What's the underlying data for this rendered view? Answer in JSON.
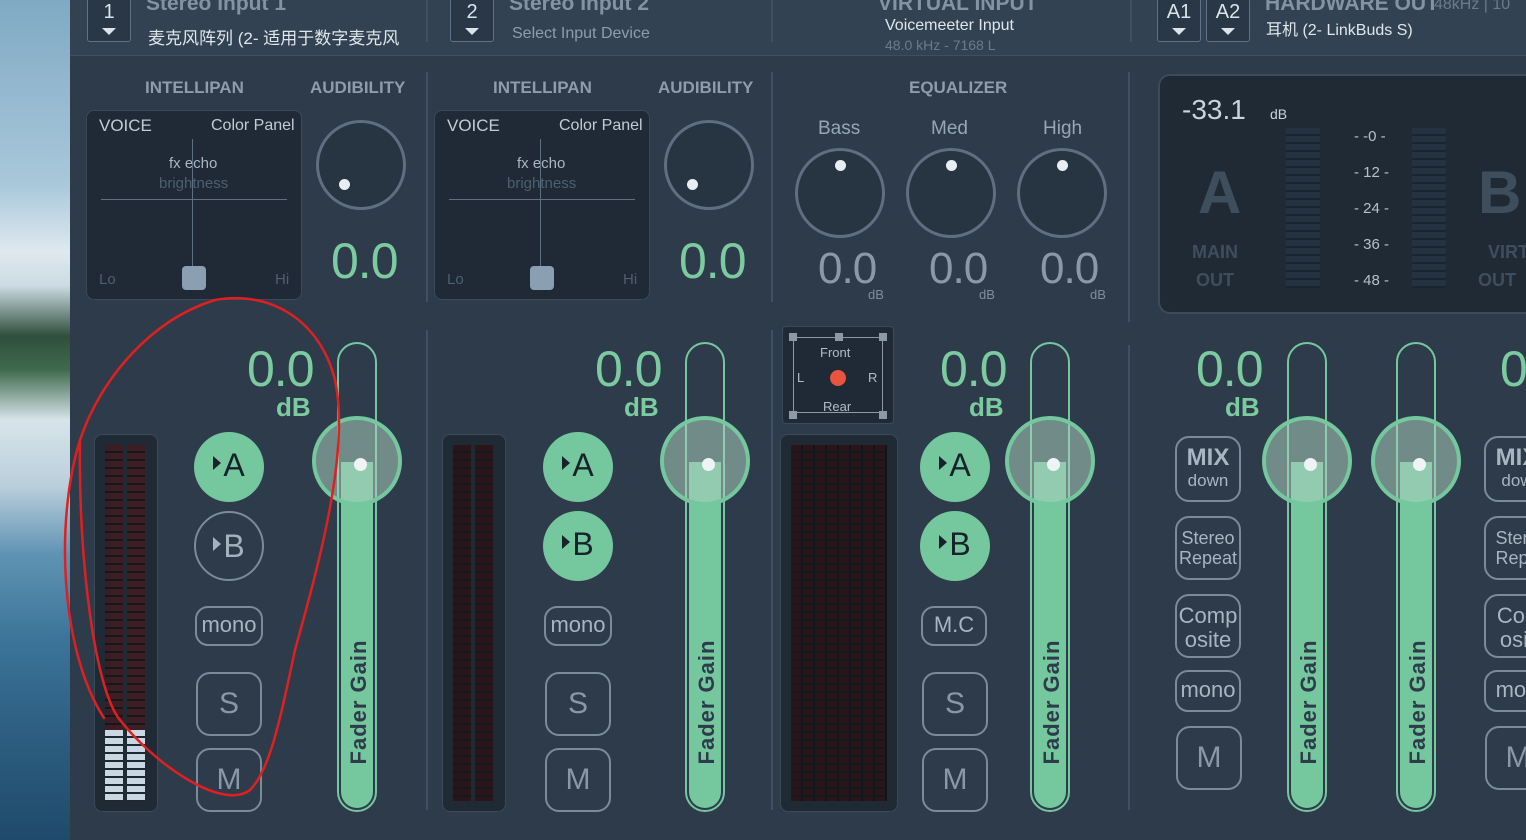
{
  "header": {
    "strip1": {
      "num": "1",
      "title": "Stereo Input 1",
      "device": "麦克风阵列 (2- 适用于数字麦克风"
    },
    "strip2": {
      "num": "2",
      "title": "Stereo Input 2",
      "device": "Select Input Device"
    },
    "virtual": {
      "title": "VIRTUAL INPUT",
      "name": "Voicemeeter Input",
      "info": "48.0 kHz - 7168 L"
    },
    "hw": {
      "a1": "A1",
      "a2": "A2",
      "title": "HARDWARE OUT",
      "device": "耳机 (2- LinkBuds S)",
      "rate": "48kHz | 10"
    }
  },
  "labels": {
    "intellipan": "INTELLIPAN",
    "audibility": "AUDIBILITY",
    "equalizer": "EQUALIZER"
  },
  "intellipan": {
    "voice": "VOICE",
    "color_panel": "Color Panel",
    "fx": "fx echo",
    "brightness": "brightness",
    "lo": "Lo",
    "hi": "Hi"
  },
  "strip1": {
    "audibility": "0.0",
    "gain": "0.0",
    "db": "dB",
    "a": "A",
    "b": "B",
    "mono": "mono",
    "s": "S",
    "m": "M",
    "fader": "Fader Gain",
    "meter_level": 0.2
  },
  "strip2": {
    "audibility": "0.0",
    "gain": "0.0",
    "db": "dB",
    "a": "A",
    "b": "B",
    "mono": "mono",
    "s": "S",
    "m": "M",
    "fader": "Fader Gain",
    "meter_level": 0.0
  },
  "eq": {
    "bass_label": "Bass",
    "med_label": "Med",
    "high_label": "High",
    "bass": "0.0",
    "med": "0.0",
    "high": "0.0",
    "unit": "dB"
  },
  "panner": {
    "front": "Front",
    "rear": "Rear",
    "l": "L",
    "r": "R"
  },
  "virtual_strip": {
    "gain": "0.0",
    "db": "dB",
    "a": "A",
    "b": "B",
    "mc": "M.C",
    "s": "S",
    "m": "M",
    "fader": "Fader Gain"
  },
  "hwout": {
    "level": "-33.1",
    "level_unit": "dB",
    "a_big": "A",
    "a_main": "MAIN",
    "a_out": "OUT",
    "b_big": "B",
    "b_main": "VIRTUAL",
    "b_out": "OUT",
    "scale": [
      "- -0 -",
      "- 12 -",
      "- 24 -",
      "- 36 -",
      "- 48 -"
    ]
  },
  "bus_a": {
    "gain": "0.0",
    "db": "dB",
    "mix": "MIX",
    "mix_sub": "down",
    "stereo": "Stereo",
    "repeat": "Repeat",
    "comp1": "Comp",
    "comp2": "osite",
    "mono": "mono",
    "m": "M",
    "fader1": "Fader Gain",
    "fader2": "Fader Gain"
  },
  "bus_b": {
    "gain": "0",
    "mix": "MIX",
    "mix_sub": "dow",
    "stereo": "Stere",
    "repeat": "Repe",
    "comp1": "Con",
    "comp2": "osit",
    "mono": "mon",
    "m": "M"
  },
  "colors": {
    "accent": "#75c79e",
    "panel": "#2d3b4a",
    "annotation": "#e02020"
  }
}
